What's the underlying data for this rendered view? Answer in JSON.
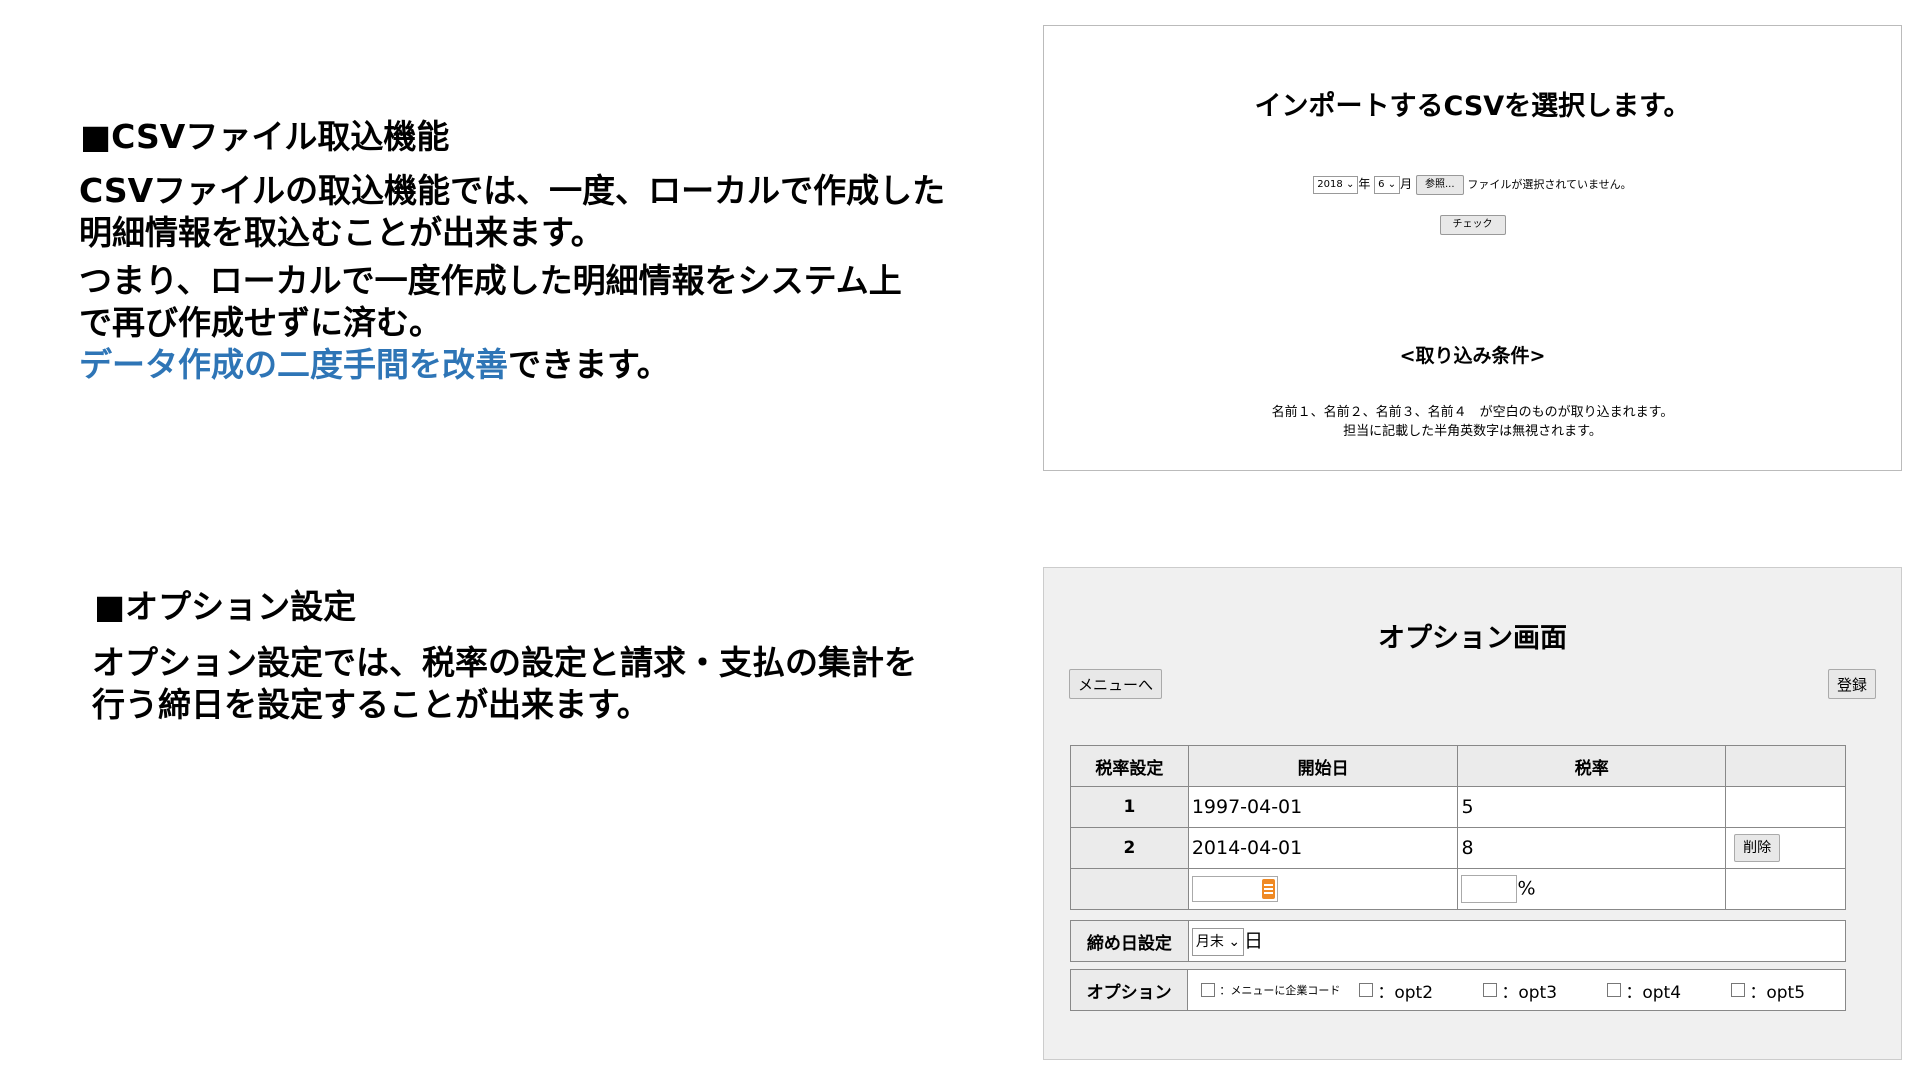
{
  "colors": {
    "accent": "#2e75b6"
  },
  "section_csv": {
    "heading": "■CSVファイル取込機能",
    "line1": "CSVファイルの取込機能では、一度、ローカルで作成した",
    "line2": "明細情報を取込むことが出来ます。",
    "line3": "つまり、ローカルで一度作成した明細情報をシステム上",
    "line4": "で再び作成せずに済む。",
    "line5_accent": "データ作成の二度手間を改善",
    "line5_rest": "できます。"
  },
  "section_option": {
    "heading": "■オプション設定",
    "line1": "オプション設定では、税率の設定と請求・支払の集計を",
    "line2": "行う締日を設定することが出来ます。"
  },
  "csv_screen": {
    "title": "インポートするCSVを選択します。",
    "year_value": "2018",
    "year_suffix": "年",
    "month_value": "6",
    "month_suffix": "月",
    "browse_label": "参照...",
    "file_status": "ファイルが選択されていません。",
    "check_label": "チェック",
    "conditions_title": "<取り込み条件>",
    "conditions_line1": "名前１、名前２、名前３、名前４　が空白のものが取り込まれます。",
    "conditions_line2": "担当に記載した半角英数字は無視されます。"
  },
  "option_screen": {
    "title": "オプション画面",
    "menu_button": "メニューへ",
    "register_button": "登録",
    "tax_table": {
      "header_label": "税率設定",
      "col_start": "開始日",
      "col_rate": "税率",
      "rows": [
        {
          "no": "1",
          "start": "1997-04-01",
          "rate": "5"
        },
        {
          "no": "2",
          "start": "2014-04-01",
          "rate": "8",
          "action": "削除"
        }
      ],
      "percent_suffix": "%"
    },
    "closing": {
      "label": "締め日設定",
      "select_value": "月末",
      "suffix": "日"
    },
    "options": {
      "label": "オプション",
      "items": [
        {
          "checked": false,
          "text": "：メニューに企業コード"
        },
        {
          "checked": false,
          "text": "：opt2"
        },
        {
          "checked": false,
          "text": "：opt3"
        },
        {
          "checked": false,
          "text": "：opt4"
        },
        {
          "checked": false,
          "text": "：opt5"
        }
      ]
    }
  }
}
